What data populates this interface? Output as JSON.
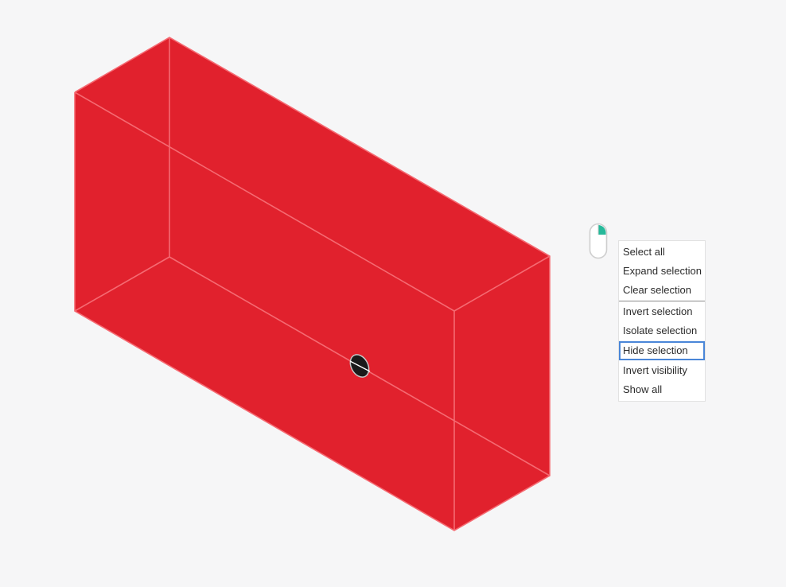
{
  "viewport": {
    "background": "#f6f6f7",
    "box_fill": "#e1212d",
    "edge_color": "#f56a72",
    "selection_marker": "black-ellipse-marker"
  },
  "mouse_hint": {
    "icon": "mouse-right-click-icon",
    "accent": "#26b99a"
  },
  "context_menu": {
    "groups": [
      [
        "Select all",
        "Expand selection",
        "Clear selection"
      ],
      [
        "Invert selection",
        "Isolate selection",
        "Hide selection",
        "Invert visibility",
        "Show all"
      ]
    ],
    "highlighted": "Hide selection",
    "highlight_color": "#4a86d8"
  }
}
